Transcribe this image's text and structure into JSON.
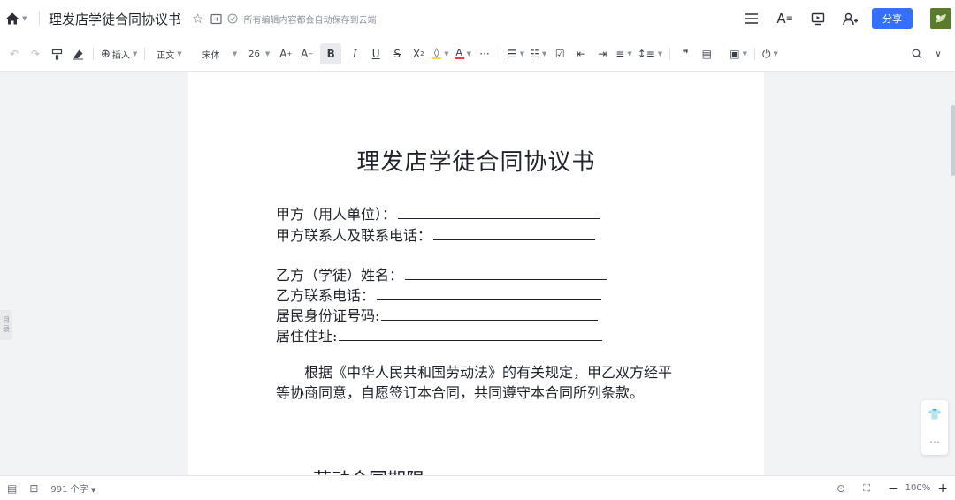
{
  "header": {
    "title": "理发店学徒合同协议书",
    "save_status": "所有编辑内容都会自动保存到云端",
    "share_label": "分享"
  },
  "toolbar": {
    "insert_label": "插入",
    "style_label": "正文",
    "font_label": "宋体",
    "size_label": "26"
  },
  "outline_tab": {
    "line1": "目",
    "line2": "录"
  },
  "document": {
    "title": "理发店学徒合同协议书",
    "party_a_label": "甲方（用人单位）：",
    "party_a_contact_label": "甲方联系人及联系电话：",
    "party_b_label": "乙方（学徒）姓名：",
    "party_b_phone_label": "乙方联系电话：",
    "id_label": "居民身份证号码:",
    "address_label": "居住住址:",
    "intro_paragraph": "　　根据《中华人民共和国劳动法》的有关规定，甲乙双方经平等协商同意，自愿签订本合同，共同遵守本合同所列条款。",
    "section_1_heading": "一、劳动合同期限"
  },
  "statusbar": {
    "word_count": "991 个字",
    "zoom": "100%"
  },
  "colors": {
    "accent": "#3370ff",
    "highlight": "#f7d94c",
    "font_color": "#e63a3a"
  }
}
